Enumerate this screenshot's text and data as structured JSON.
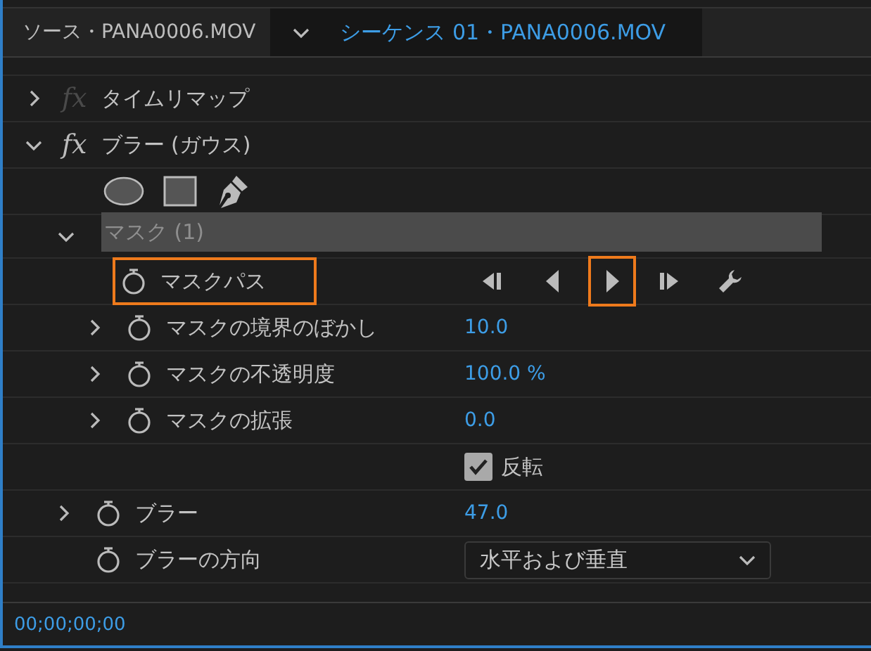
{
  "tabs": [
    {
      "label": "ソース・PANA0006.MOV",
      "selected": false,
      "menu": false
    },
    {
      "label": "シーケンス 01・PANA0006.MOV",
      "selected": true,
      "menu": true
    }
  ],
  "effects": [
    {
      "name": "タイムリマップ",
      "expanded": false,
      "fx_enabled": false,
      "fx": "fx"
    },
    {
      "name": "ブラー (ガウス)",
      "expanded": true,
      "fx_enabled": true,
      "fx": "fx"
    }
  ],
  "mask": {
    "name": "マスク (1)",
    "expanded": true
  },
  "mask_path": {
    "label": "マスクパス",
    "highlighted": true,
    "transport": [
      {
        "kind": "prev",
        "highlighted": false
      },
      {
        "kind": "back",
        "highlighted": false
      },
      {
        "kind": "forward",
        "highlighted": true
      },
      {
        "kind": "next",
        "highlighted": false
      },
      {
        "kind": "wrench",
        "highlighted": false
      }
    ]
  },
  "mask_properties": [
    {
      "label": "マスクの境界のぼかし",
      "value": "10.0",
      "expanded": false
    },
    {
      "label": "マスクの不透明度",
      "value": "100.0 %",
      "expanded": false
    },
    {
      "label": "マスクの拡張",
      "value": "0.0",
      "expanded": false
    }
  ],
  "invert": {
    "label": "反転",
    "checked": true
  },
  "blur_properties": [
    {
      "kind": "value",
      "label": "ブラー",
      "value": "47.0",
      "expanded": false
    },
    {
      "kind": "dropdown",
      "label": "ブラーの方向",
      "value": "水平および垂直"
    }
  ],
  "timecode": "00;00;00;00"
}
